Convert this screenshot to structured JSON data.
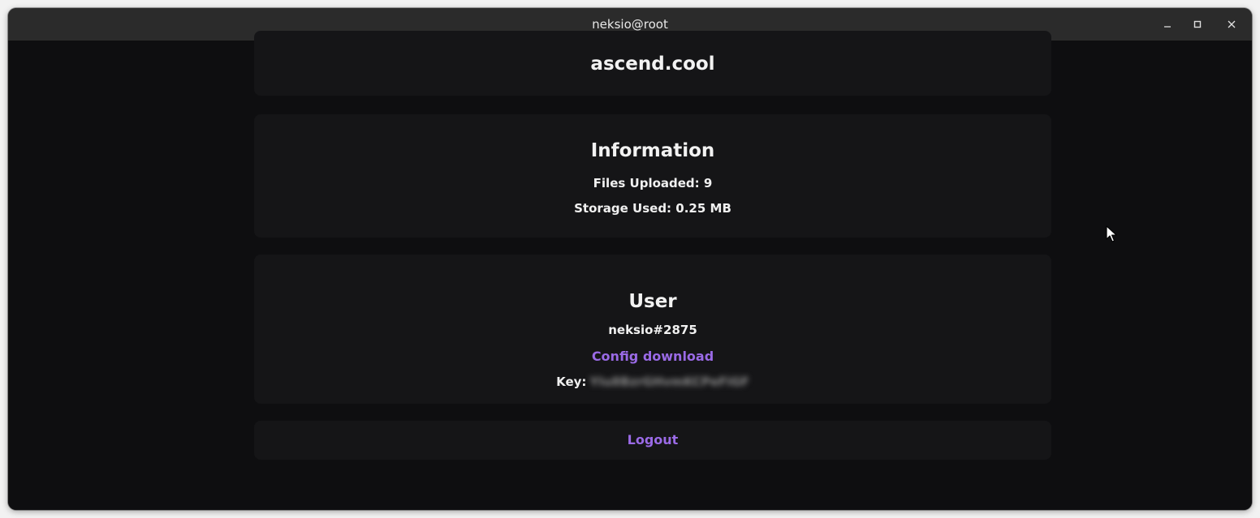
{
  "window": {
    "title": "neksio@root"
  },
  "icons": {
    "minimize": "minimize-icon",
    "maximize": "maximize-icon",
    "close": "close-icon",
    "cursor": "mouse-cursor-icon"
  },
  "site": {
    "title": "ascend.cool"
  },
  "information": {
    "title": "Information",
    "files_uploaded": "Files Uploaded: 9",
    "storage_used": "Storage Used: 0.25 MB"
  },
  "user": {
    "title": "User",
    "username": "neksio#2875",
    "config_link": "Config download",
    "key_label": "Key:",
    "key_value": "YIu8BzrGHvmKCPeFiGF"
  },
  "logout": {
    "label": "Logout"
  },
  "colors": {
    "background": "#0e0e10",
    "card": "#151517",
    "accent": "#9a6ae6",
    "titlebar": "#2b2b2b",
    "text": "#f2f2f2"
  }
}
